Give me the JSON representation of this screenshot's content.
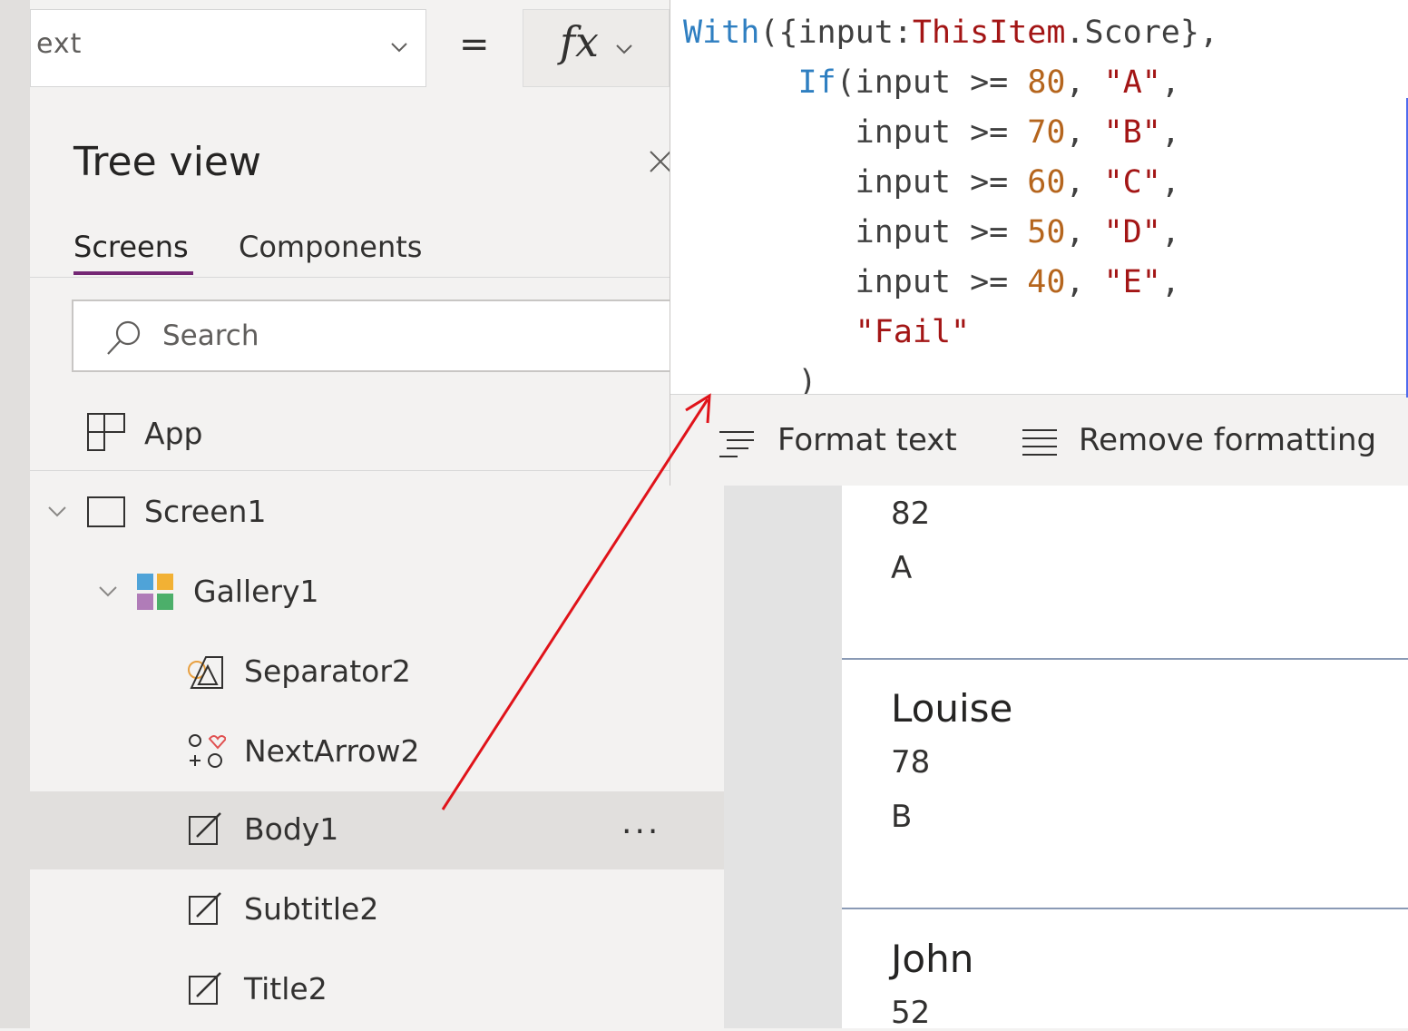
{
  "property_bar": {
    "property_value": "ext",
    "equals": "=",
    "fx_label": "fx"
  },
  "formula": {
    "lines": [
      [
        {
          "t": "With",
          "c": "kw"
        },
        {
          "t": "({input:",
          "c": ""
        },
        {
          "t": "ThisItem",
          "c": "str"
        },
        {
          "t": ".Score},",
          "c": ""
        }
      ],
      [
        {
          "t": "      ",
          "c": ""
        },
        {
          "t": "If",
          "c": "kw"
        },
        {
          "t": "(input >= ",
          "c": ""
        },
        {
          "t": "80",
          "c": "num"
        },
        {
          "t": ", ",
          "c": ""
        },
        {
          "t": "\"A\"",
          "c": "str"
        },
        {
          "t": ",",
          "c": ""
        }
      ],
      [
        {
          "t": "         input >= ",
          "c": ""
        },
        {
          "t": "70",
          "c": "num"
        },
        {
          "t": ", ",
          "c": ""
        },
        {
          "t": "\"B\"",
          "c": "str"
        },
        {
          "t": ",",
          "c": ""
        }
      ],
      [
        {
          "t": "         input >= ",
          "c": ""
        },
        {
          "t": "60",
          "c": "num"
        },
        {
          "t": ", ",
          "c": ""
        },
        {
          "t": "\"C\"",
          "c": "str"
        },
        {
          "t": ",",
          "c": ""
        }
      ],
      [
        {
          "t": "         input >= ",
          "c": ""
        },
        {
          "t": "50",
          "c": "num"
        },
        {
          "t": ", ",
          "c": ""
        },
        {
          "t": "\"D\"",
          "c": "str"
        },
        {
          "t": ",",
          "c": ""
        }
      ],
      [
        {
          "t": "         input >= ",
          "c": ""
        },
        {
          "t": "40",
          "c": "num"
        },
        {
          "t": ", ",
          "c": ""
        },
        {
          "t": "\"E\"",
          "c": "str"
        },
        {
          "t": ",",
          "c": ""
        }
      ],
      [
        {
          "t": "         ",
          "c": ""
        },
        {
          "t": "\"Fail\"",
          "c": "str"
        }
      ],
      [
        {
          "t": "      )",
          "c": ""
        }
      ]
    ],
    "format_text_label": "Format text",
    "remove_formatting_label": "Remove formatting"
  },
  "tree_view": {
    "title": "Tree view",
    "tabs": [
      {
        "label": "Screens",
        "active": true
      },
      {
        "label": "Components",
        "active": false
      }
    ],
    "search_placeholder": "Search",
    "app_label": "App",
    "items": [
      {
        "label": "Screen1",
        "icon": "screen-icon",
        "expanded": true
      },
      {
        "label": "Gallery1",
        "icon": "gallery-icon",
        "expanded": true
      },
      {
        "label": "Separator2",
        "icon": "separator-icon"
      },
      {
        "label": "NextArrow2",
        "icon": "icons-control-icon"
      },
      {
        "label": "Body1",
        "icon": "edit-label-icon",
        "selected": true,
        "more": "..."
      },
      {
        "label": "Subtitle2",
        "icon": "edit-label-icon"
      },
      {
        "label": "Title2",
        "icon": "edit-label-icon"
      }
    ]
  },
  "gallery": {
    "items": [
      {
        "name": "",
        "score": "82",
        "grade": "A"
      },
      {
        "name": "Louise",
        "score": "78",
        "grade": "B"
      },
      {
        "name": "John",
        "score": "52",
        "grade": ""
      }
    ]
  },
  "colors": {
    "accent_tab": "#742774",
    "arrow": "#e0131a",
    "keyword": "#2f7fc1",
    "number": "#b5651d",
    "string": "#a31515"
  }
}
